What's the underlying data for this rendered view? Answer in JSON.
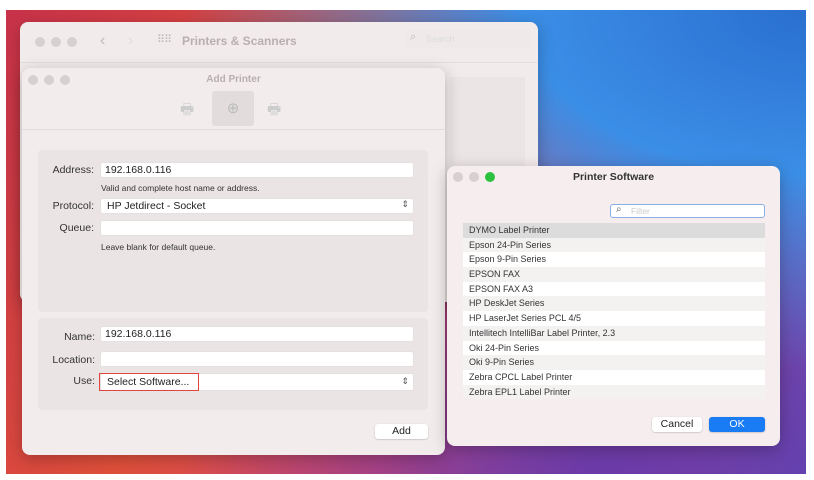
{
  "main_window": {
    "title": "Printers & Scanners",
    "search_placeholder": "Search"
  },
  "add_printer": {
    "title": "Add Printer",
    "address_label": "Address:",
    "address_value": "192.168.0.116",
    "address_hint": "Valid and complete host name or address.",
    "protocol_label": "Protocol:",
    "protocol_value": "HP Jetdirect - Socket",
    "queue_label": "Queue:",
    "queue_value": "",
    "queue_hint": "Leave blank for default queue.",
    "name_label": "Name:",
    "name_value": "192.168.0.116",
    "location_label": "Location:",
    "location_value": "",
    "use_label": "Use:",
    "use_value": "Select Software...",
    "add_label": "Add"
  },
  "printer_software": {
    "title": "Printer Software",
    "filter_placeholder": "Filter",
    "items": [
      "DYMO Label Printer",
      "Epson 24-Pin Series",
      "Epson 9-Pin Series",
      "EPSON FAX",
      "EPSON FAX A3",
      "HP DeskJet Series",
      "HP LaserJet Series PCL 4/5",
      "Intellitech IntelliBar Label Printer, 2.3",
      "Oki 24-Pin Series",
      "Oki 9-Pin Series",
      "Zebra CPCL Label Printer",
      "Zebra EPL1 Label Printer"
    ],
    "selected_index": 0,
    "cancel_label": "Cancel",
    "ok_label": "OK"
  },
  "colors": {
    "accent": "#1a7cf5",
    "highlight": "#e0463f"
  }
}
